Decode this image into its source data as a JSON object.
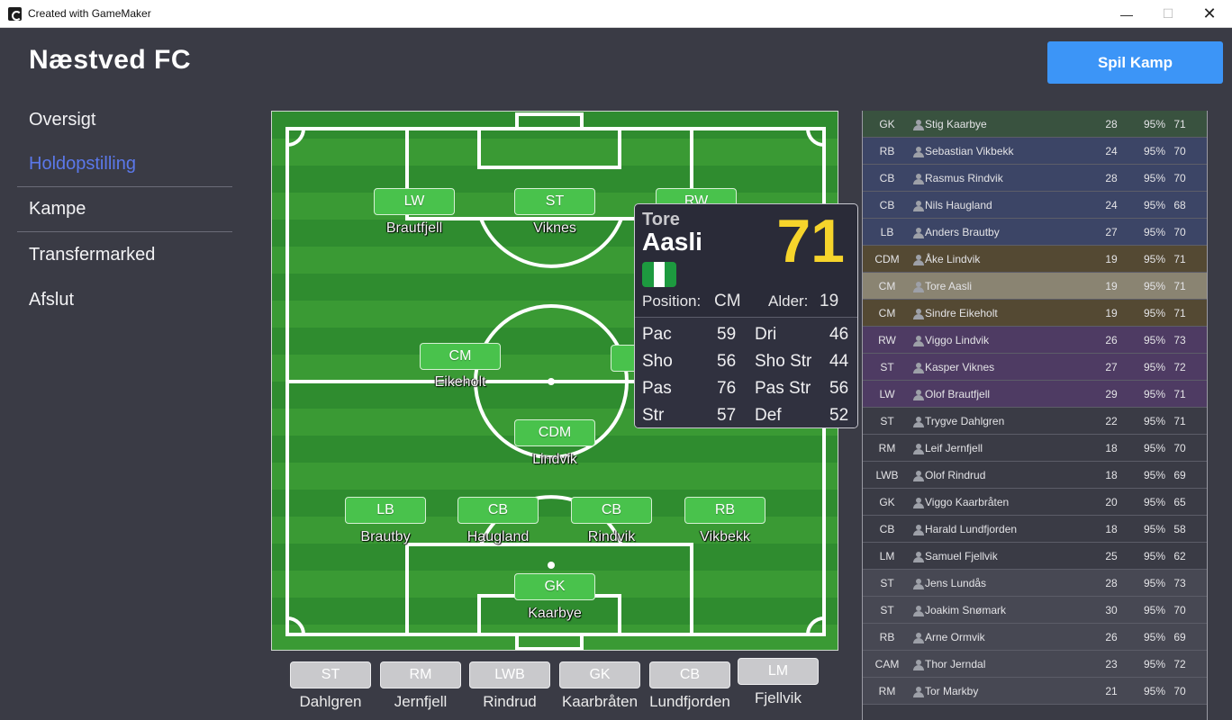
{
  "window": {
    "title": "Created with GameMaker"
  },
  "club": {
    "name": "Næstved FC"
  },
  "nav": [
    "Oversigt",
    "Holdopstilling",
    "Kampe",
    "Transfermarked",
    "Afslut"
  ],
  "play_button": "Spil Kamp",
  "lineup": [
    {
      "pos": "LW",
      "name": "Brautfjell"
    },
    {
      "pos": "ST",
      "name": "Viknes"
    },
    {
      "pos": "RW",
      "name": ""
    },
    {
      "pos": "CM",
      "name": "Eikeholt"
    },
    {
      "pos": "CDM",
      "name": "Lindvik"
    },
    {
      "pos": "LB",
      "name": "Brautby"
    },
    {
      "pos": "CB",
      "name": "Haugland"
    },
    {
      "pos": "CB",
      "name": "Rindvik"
    },
    {
      "pos": "RB",
      "name": "Vikbekk"
    },
    {
      "pos": "GK",
      "name": "Kaarbye"
    }
  ],
  "bench": [
    {
      "pos": "ST",
      "name": "Dahlgren"
    },
    {
      "pos": "RM",
      "name": "Jernfjell"
    },
    {
      "pos": "LWB",
      "name": "Rindrud"
    },
    {
      "pos": "GK",
      "name": "Kaarbråten"
    },
    {
      "pos": "CB",
      "name": "Lundfjorden"
    },
    {
      "pos": "LM",
      "name": "Fjellvik"
    }
  ],
  "player_card": {
    "first_name": "Tore",
    "last_name": "Aasli",
    "rating": "71",
    "position_label": "Position:",
    "position": "CM",
    "age_label": "Alder:",
    "age": "19",
    "flag_colors": [
      "#1d9a3f",
      "#ffffff",
      "#1d9a3f"
    ],
    "stats": [
      {
        "label": "Pac",
        "value": "59"
      },
      {
        "label": "Dri",
        "value": "46"
      },
      {
        "label": "Sho",
        "value": "56"
      },
      {
        "label": "Sho Str",
        "value": "44"
      },
      {
        "label": "Pas",
        "value": "76"
      },
      {
        "label": "Pas Str",
        "value": "56"
      },
      {
        "label": "Str",
        "value": "57"
      },
      {
        "label": "Def",
        "value": "52"
      }
    ]
  },
  "squad_colors": {
    "gk": "#39523f",
    "def": "#3c4566",
    "mid": "#544933",
    "mid_highlight": "#8a8472",
    "att": "#4e3b63",
    "bench": "#3a3b45",
    "reserve": "#474853"
  },
  "squad": [
    {
      "pos": "GK",
      "name": "Stig Kaarbye",
      "age": "28",
      "fit": "95%",
      "ovr": "71",
      "group": "gk"
    },
    {
      "pos": "RB",
      "name": "Sebastian Vikbekk",
      "age": "24",
      "fit": "95%",
      "ovr": "70",
      "group": "def"
    },
    {
      "pos": "CB",
      "name": "Rasmus Rindvik",
      "age": "28",
      "fit": "95%",
      "ovr": "70",
      "group": "def"
    },
    {
      "pos": "CB",
      "name": "Nils Haugland",
      "age": "24",
      "fit": "95%",
      "ovr": "68",
      "group": "def"
    },
    {
      "pos": "LB",
      "name": "Anders Brautby",
      "age": "27",
      "fit": "95%",
      "ovr": "70",
      "group": "def"
    },
    {
      "pos": "CDM",
      "name": "Åke Lindvik",
      "age": "19",
      "fit": "95%",
      "ovr": "71",
      "group": "mid"
    },
    {
      "pos": "CM",
      "name": "Tore Aasli",
      "age": "19",
      "fit": "95%",
      "ovr": "71",
      "group": "mid_highlight"
    },
    {
      "pos": "CM",
      "name": "Sindre Eikeholt",
      "age": "19",
      "fit": "95%",
      "ovr": "71",
      "group": "mid"
    },
    {
      "pos": "RW",
      "name": "Viggo Lindvik",
      "age": "26",
      "fit": "95%",
      "ovr": "73",
      "group": "att"
    },
    {
      "pos": "ST",
      "name": "Kasper Viknes",
      "age": "27",
      "fit": "95%",
      "ovr": "72",
      "group": "att"
    },
    {
      "pos": "LW",
      "name": "Olof Brautfjell",
      "age": "29",
      "fit": "95%",
      "ovr": "71",
      "group": "att"
    },
    {
      "pos": "ST",
      "name": "Trygve Dahlgren",
      "age": "22",
      "fit": "95%",
      "ovr": "71",
      "group": "bench"
    },
    {
      "pos": "RM",
      "name": "Leif Jernfjell",
      "age": "18",
      "fit": "95%",
      "ovr": "70",
      "group": "bench"
    },
    {
      "pos": "LWB",
      "name": "Olof Rindrud",
      "age": "18",
      "fit": "95%",
      "ovr": "69",
      "group": "bench"
    },
    {
      "pos": "GK",
      "name": "Viggo Kaarbråten",
      "age": "20",
      "fit": "95%",
      "ovr": "65",
      "group": "bench"
    },
    {
      "pos": "CB",
      "name": "Harald Lundfjorden",
      "age": "18",
      "fit": "95%",
      "ovr": "58",
      "group": "bench"
    },
    {
      "pos": "LM",
      "name": "Samuel Fjellvik",
      "age": "25",
      "fit": "95%",
      "ovr": "62",
      "group": "bench"
    },
    {
      "pos": "ST",
      "name": "Jens Lundås",
      "age": "28",
      "fit": "95%",
      "ovr": "73",
      "group": "reserve"
    },
    {
      "pos": "ST",
      "name": "Joakim Snømark",
      "age": "30",
      "fit": "95%",
      "ovr": "70",
      "group": "reserve"
    },
    {
      "pos": "RB",
      "name": "Arne Ormvik",
      "age": "26",
      "fit": "95%",
      "ovr": "69",
      "group": "reserve"
    },
    {
      "pos": "CAM",
      "name": "Thor Jerndal",
      "age": "23",
      "fit": "95%",
      "ovr": "72",
      "group": "reserve"
    },
    {
      "pos": "RM",
      "name": "Tor Markby",
      "age": "21",
      "fit": "95%",
      "ovr": "70",
      "group": "reserve"
    }
  ]
}
